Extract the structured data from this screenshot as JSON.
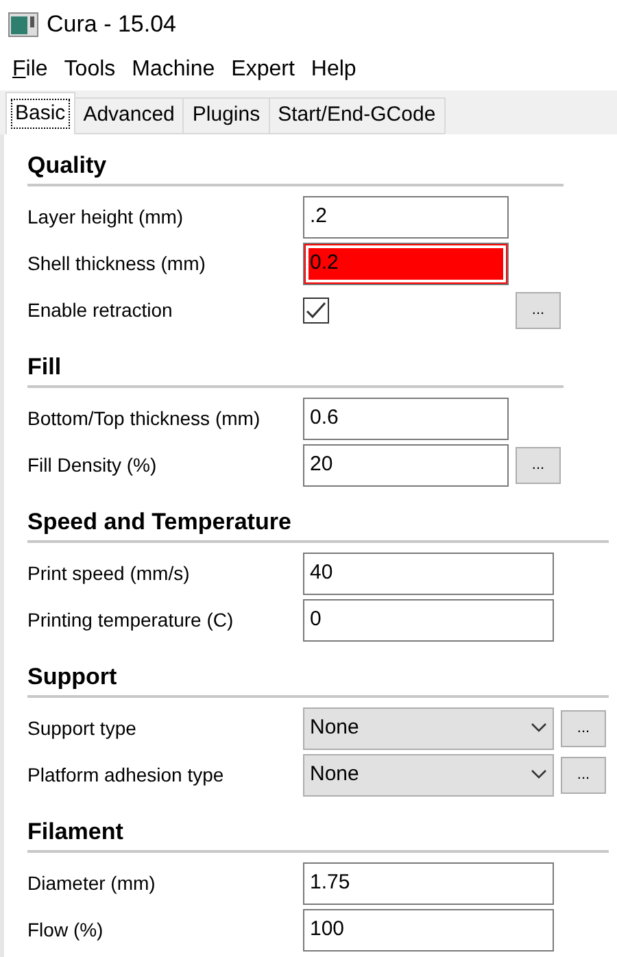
{
  "window": {
    "title": "Cura - 15.04"
  },
  "menu": [
    {
      "label": "File",
      "mnemonic": true
    },
    {
      "label": "Tools",
      "mnemonic": false
    },
    {
      "label": "Machine",
      "mnemonic": false
    },
    {
      "label": "Expert",
      "mnemonic": false
    },
    {
      "label": "Help",
      "mnemonic": false
    }
  ],
  "tabs": [
    {
      "label": "Basic",
      "selected": true
    },
    {
      "label": "Advanced",
      "selected": false
    },
    {
      "label": "Plugins",
      "selected": false
    },
    {
      "label": "Start/End-GCode",
      "selected": false
    }
  ],
  "sections": [
    {
      "title": "Quality",
      "settings": [
        {
          "label": "Layer height (mm)",
          "kind": "text",
          "value": ".2",
          "invalid": false,
          "has_options": false
        },
        {
          "label": "Shell thickness (mm)",
          "kind": "text",
          "value": "0.2",
          "invalid": true,
          "has_options": false
        },
        {
          "label": "Enable retraction",
          "kind": "checkbox",
          "checked": true,
          "has_options": true,
          "options_label": "..."
        }
      ]
    },
    {
      "title": "Fill",
      "settings": [
        {
          "label": "Bottom/Top thickness (mm)",
          "kind": "text",
          "value": "0.6",
          "invalid": false,
          "has_options": false
        },
        {
          "label": "Fill Density (%)",
          "kind": "text",
          "value": "20",
          "invalid": false,
          "has_options": true,
          "options_label": "..."
        }
      ]
    },
    {
      "title": "Speed and Temperature",
      "settings": [
        {
          "label": "Print speed (mm/s)",
          "kind": "text",
          "value": "40",
          "invalid": false,
          "has_options": false
        },
        {
          "label": "Printing temperature (C)",
          "kind": "text",
          "value": "0",
          "invalid": false,
          "has_options": false
        }
      ]
    },
    {
      "title": "Support",
      "settings": [
        {
          "label": "Support type",
          "kind": "select",
          "value": "None",
          "has_options": true,
          "options_label": "..."
        },
        {
          "label": "Platform adhesion type",
          "kind": "select",
          "value": "None",
          "has_options": true,
          "options_label": "..."
        }
      ]
    },
    {
      "title": "Filament",
      "settings": [
        {
          "label": "Diameter (mm)",
          "kind": "text",
          "value": "1.75",
          "invalid": false,
          "has_options": false
        },
        {
          "label": "Flow (%)",
          "kind": "text",
          "value": "100",
          "invalid": false,
          "has_options": false
        }
      ]
    }
  ]
}
